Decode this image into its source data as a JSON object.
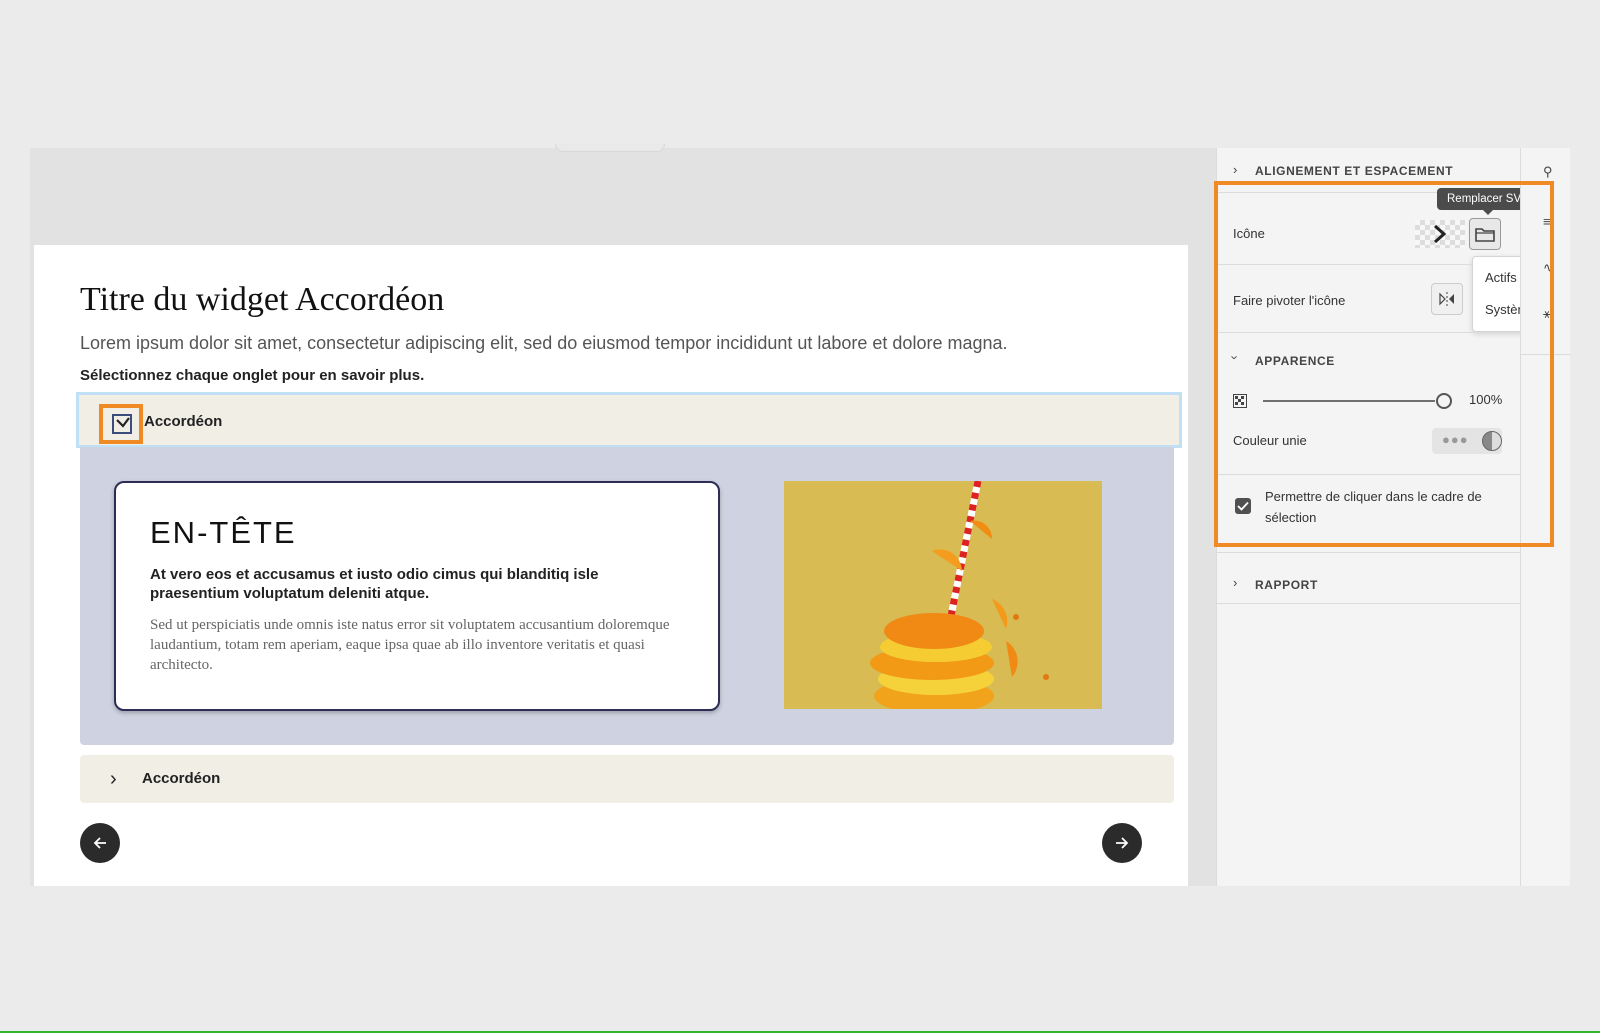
{
  "slide": {
    "title": "Titre du widget Accordéon",
    "description": "Lorem ipsum dolor sit amet, consectetur adipiscing elit, sed do eiusmod tempor incididunt ut labore et dolore magna.",
    "instruction": "Sélectionnez chaque onglet pour en savoir plus.",
    "accordion_1_label": "Accordéon",
    "accordion_2_label": "Accordéon",
    "card": {
      "title": "EN-TÊTE",
      "subtitle": "At vero eos et accusamus et iusto odio cimus qui blanditiq isle praesentium voluptatum deleniti atque.",
      "body": "Sed ut perspiciatis unde omnis iste natus error sit voluptatem accusantium doloremque laudantium, totam rem aperiam, eaque ipsa quae ab illo inventore veritatis et quasi architecto."
    }
  },
  "panel": {
    "section_alignment": "ALIGNEMENT ET ESPACEMENT",
    "icon_label": "Icône",
    "tooltip": "Remplacer SVG",
    "dropdown_items": [
      "Actifs",
      "Système"
    ],
    "rotate_label": "Faire pivoter l'icône",
    "section_appearance": "APPARENCE",
    "opacity_value": "100%",
    "solid_color_label": "Couleur unie",
    "allow_click_label": "Permettre de cliquer dans le cadre de sélection",
    "section_report": "RAPPORT"
  },
  "colors": {
    "highlight": "#f08a24",
    "accordion_bg": "#f1eee6",
    "panel_bg": "#cfd2e0",
    "nav_button": "#2b2b2b"
  },
  "icons": [
    "checkbox-icon",
    "chevron-right-icon",
    "arrow-left-icon",
    "arrow-right-icon",
    "folder-icon",
    "flip-icon",
    "checkerboard-icon",
    "color-swatch-icon"
  ]
}
